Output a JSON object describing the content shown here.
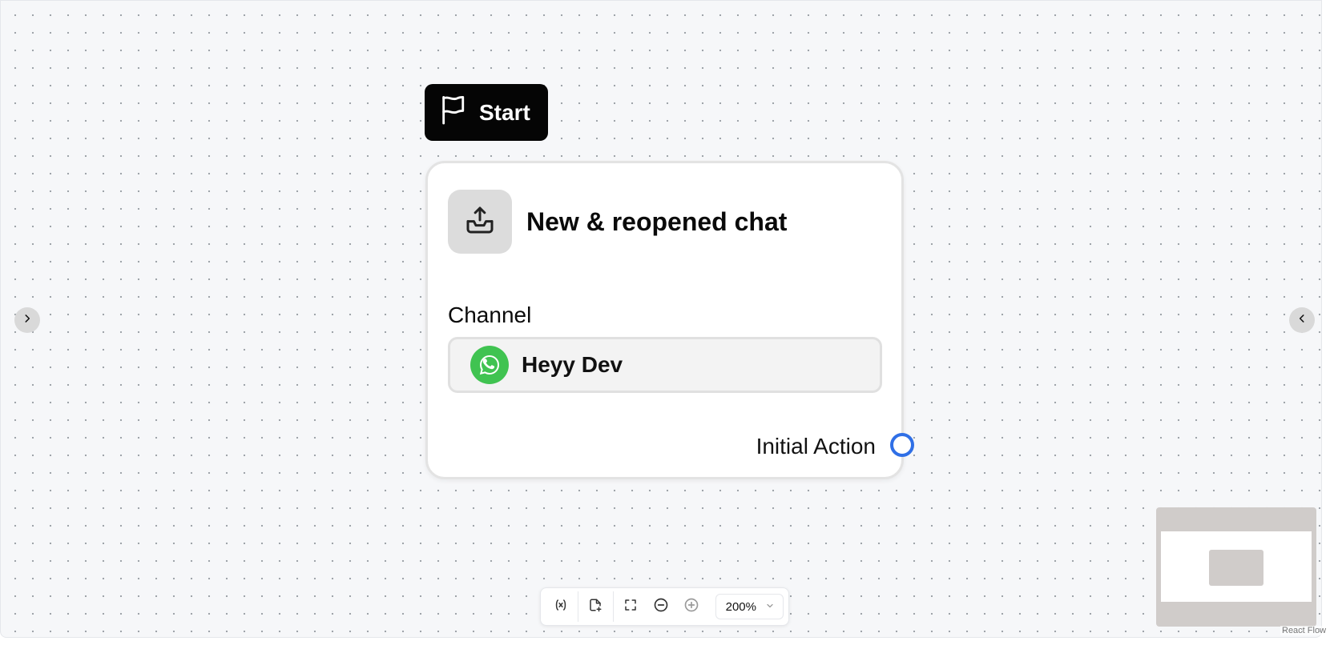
{
  "start_node": {
    "label": "Start",
    "icon": "flag-icon"
  },
  "trigger_node": {
    "title": "New & reopened chat",
    "icon": "inbox-upload-icon",
    "channel": {
      "label": "Channel",
      "value": "Heyy Dev",
      "icon": "whatsapp-icon",
      "icon_color": "#40c351"
    },
    "output_handle": {
      "label": "Initial Action",
      "color": "#2f6fe6"
    }
  },
  "left_panel_toggle": {
    "icon": "chevron-right-icon"
  },
  "right_panel_toggle": {
    "icon": "chevron-left-icon"
  },
  "toolbar": {
    "items": [
      {
        "icon": "variable-icon"
      },
      {
        "icon": "add-file-icon"
      },
      {
        "icon": "fit-view-icon"
      },
      {
        "icon": "zoom-out-icon"
      },
      {
        "icon": "zoom-in-icon"
      }
    ],
    "zoom_level": "200%"
  },
  "attribution": "React Flow"
}
